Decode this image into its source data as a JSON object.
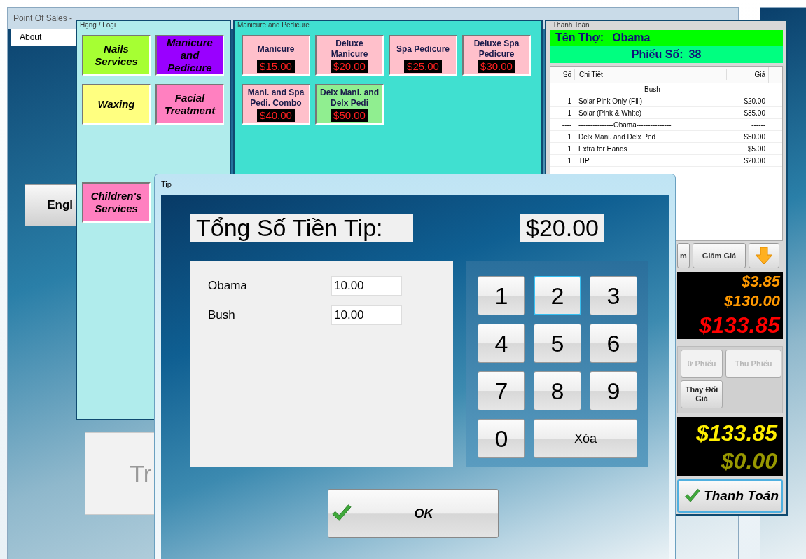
{
  "main_window": {
    "title": "Point Of Sales -",
    "menu": [
      "About"
    ],
    "language_button": "Engl",
    "back_button": {
      "label": "Tr",
      "disabled": true
    }
  },
  "categories": {
    "title": "Hạng / Loại",
    "items": [
      {
        "label": "Nails Services",
        "color": "#a6ff33"
      },
      {
        "label": "Manicure and Pedicure",
        "color": "#9900ff"
      },
      {
        "label": "Waxing",
        "color": "#ffff80"
      },
      {
        "label": "Facial Treatment",
        "color": "#ff80c0"
      },
      {
        "label": "Children's Services",
        "color": "#ff80c0"
      }
    ]
  },
  "services": {
    "title": "Manicure and Pedicure",
    "items": [
      {
        "label": "Manicure",
        "price": "$15.00",
        "color": "#ffc0cb"
      },
      {
        "label": "Deluxe Manicure",
        "price": "$20.00",
        "color": "#ffc0cb"
      },
      {
        "label": "Spa Pedicure",
        "price": "$25.00",
        "color": "#ffc0cb"
      },
      {
        "label": "Deluxe Spa Pedicure",
        "price": "$30.00",
        "color": "#ffc0cb"
      },
      {
        "label": "Mani. and Spa Pedi. Combo",
        "price": "$40.00",
        "color": "#ffc0cb"
      },
      {
        "label": "Delx Mani. and Delx Pedi",
        "price": "$50.00",
        "color": "#90ee90"
      }
    ]
  },
  "checkout": {
    "title": "Thanh Toán",
    "technician_label": "Tên Thợ:",
    "technician": "Obama",
    "ticket_label": "Phiếu Số:",
    "ticket": "38",
    "columns": [
      "Số",
      "Chi Tiết",
      "Giá"
    ],
    "rows": [
      {
        "kind": "group",
        "detail": "Bush"
      },
      {
        "kind": "item",
        "qty": "1",
        "detail": "Solar Pink Only (Fill)",
        "price": "$20.00"
      },
      {
        "kind": "item",
        "qty": "1",
        "detail": "Solar (Pink & White)",
        "price": "$35.00"
      },
      {
        "kind": "item",
        "qty": "----",
        "detail": "---------------Obama---------------",
        "price": "------"
      },
      {
        "kind": "item",
        "qty": "1",
        "detail": "Delx Mani. and Delx Ped",
        "price": "$50.00"
      },
      {
        "kind": "item",
        "qty": "1",
        "detail": "Extra for Hands",
        "price": "$5.00"
      },
      {
        "kind": "item",
        "qty": "1",
        "detail": "TIP",
        "price": "$20.00"
      }
    ],
    "tools": [
      "m",
      "Giảm Giá"
    ],
    "totals": [
      {
        "value": "$3.85",
        "color": "#ff9900",
        "kind": "small"
      },
      {
        "value": "$130.00",
        "color": "#ff9900",
        "kind": "small"
      },
      {
        "value": "$133.85",
        "color": "#ff0000",
        "kind": "large"
      }
    ],
    "actions": [
      {
        "label": "ữ Phiếu",
        "disabled": true
      },
      {
        "label": "Thu Phiếu",
        "disabled": true
      },
      {
        "label": "Thay Đổi Giá",
        "disabled": false
      }
    ],
    "balance": [
      {
        "value": "$133.85",
        "color": "#ffee00"
      },
      {
        "value": "$0.00",
        "color": "#999900"
      }
    ],
    "pay_button": "Thanh Toán"
  },
  "tip_dialog": {
    "title": "Tip",
    "heading": "Tổng Số Tiền Tip:",
    "total": "$20.00",
    "staff": [
      {
        "name": "Obama",
        "value": "10.00"
      },
      {
        "name": "Bush",
        "value": "10.00"
      }
    ],
    "keys": [
      {
        "label": "1",
        "kind": "digit",
        "focused": false
      },
      {
        "label": "2",
        "kind": "digit",
        "focused": true
      },
      {
        "label": "3",
        "kind": "digit",
        "focused": false
      },
      {
        "label": "4",
        "kind": "digit",
        "focused": false
      },
      {
        "label": "5",
        "kind": "digit",
        "focused": false
      },
      {
        "label": "6",
        "kind": "digit",
        "focused": false
      },
      {
        "label": "7",
        "kind": "digit",
        "focused": false
      },
      {
        "label": "8",
        "kind": "digit",
        "focused": false
      },
      {
        "label": "9",
        "kind": "digit",
        "focused": false
      },
      {
        "label": "0",
        "kind": "digit",
        "focused": false
      },
      {
        "label": "Xóa",
        "kind": "clear",
        "focused": false
      }
    ],
    "ok_button": "OK"
  }
}
